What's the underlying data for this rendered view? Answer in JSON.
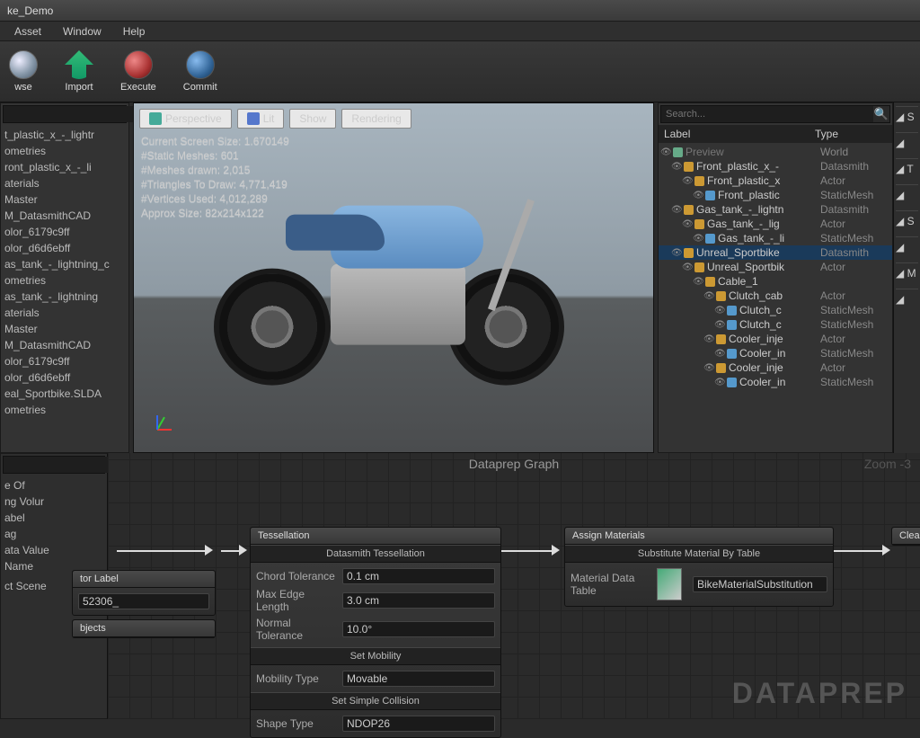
{
  "titlebar": {
    "title": "ke_Demo"
  },
  "menubar": {
    "asset": "Asset",
    "window": "Window",
    "help": "Help"
  },
  "toolbar": {
    "browse": "wse",
    "import": "Import",
    "execute": "Execute",
    "commit": "Commit"
  },
  "left_search_placeholder": "",
  "left_tree": [
    "t_plastic_x_-_lightr",
    "ometries",
    "ront_plastic_x_-_li",
    "aterials",
    "Master",
    "M_DatasmithCAD",
    "olor_6179c9ff",
    "olor_d6d6ebff",
    "as_tank_-_lightning_c",
    "ometries",
    "as_tank_-_lightning",
    "aterials",
    "Master",
    "M_DatasmithCAD",
    "olor_6179c9ff",
    "olor_d6d6ebff",
    "eal_Sportbike.SLDA",
    "ometries"
  ],
  "left_lower_search_placeholder": "",
  "left_lower": [
    "e Of",
    "ng Volur",
    "abel",
    "ag",
    "ata Value",
    "Name",
    "",
    "ct Scene"
  ],
  "viewport": {
    "btn_perspective": "Perspective",
    "btn_lit": "Lit",
    "btn_show": "Show",
    "btn_rendering": "Rendering",
    "stats": [
      "Current Screen Size: 1.670149",
      "#Static Meshes:  601",
      "#Meshes drawn:  2,015",
      "#Triangles To Draw: 4,771,419",
      "#Vertices Used:  4,012,289",
      "Approx Size: 82x214x122"
    ]
  },
  "outliner": {
    "search_placeholder": "Search...",
    "col_label": "Label",
    "col_type": "Type",
    "rows": [
      {
        "indent": 0,
        "icon": "world",
        "label": "Preview",
        "type": "World",
        "sel": false,
        "dim": true
      },
      {
        "indent": 1,
        "icon": "actor",
        "label": "Front_plastic_x_-",
        "type": "Datasmith",
        "sel": false
      },
      {
        "indent": 2,
        "icon": "actor",
        "label": "Front_plastic_x",
        "type": "Actor",
        "sel": false
      },
      {
        "indent": 3,
        "icon": "mesh",
        "label": "Front_plastic",
        "type": "StaticMesh",
        "sel": false
      },
      {
        "indent": 1,
        "icon": "actor",
        "label": "Gas_tank_-_lightn",
        "type": "Datasmith",
        "sel": false
      },
      {
        "indent": 2,
        "icon": "actor",
        "label": "Gas_tank_-_lig",
        "type": "Actor",
        "sel": false
      },
      {
        "indent": 3,
        "icon": "mesh",
        "label": "Gas_tank_-_li",
        "type": "StaticMesh",
        "sel": false
      },
      {
        "indent": 1,
        "icon": "actor",
        "label": "Unreal_Sportbike",
        "type": "Datasmith",
        "sel": true
      },
      {
        "indent": 2,
        "icon": "actor",
        "label": "Unreal_Sportbik",
        "type": "Actor",
        "sel": false
      },
      {
        "indent": 3,
        "icon": "actor",
        "label": "Cable_1",
        "type": "",
        "sel": false
      },
      {
        "indent": 4,
        "icon": "actor",
        "label": "Clutch_cab",
        "type": "Actor",
        "sel": false
      },
      {
        "indent": 5,
        "icon": "mesh",
        "label": "Clutch_c",
        "type": "StaticMesh",
        "sel": false
      },
      {
        "indent": 5,
        "icon": "mesh",
        "label": "Clutch_c",
        "type": "StaticMesh",
        "sel": false
      },
      {
        "indent": 4,
        "icon": "actor",
        "label": "Cooler_inje",
        "type": "Actor",
        "sel": false
      },
      {
        "indent": 5,
        "icon": "mesh",
        "label": "Cooler_in",
        "type": "StaticMesh",
        "sel": false
      },
      {
        "indent": 4,
        "icon": "actor",
        "label": "Cooler_inje",
        "type": "Actor",
        "sel": false
      },
      {
        "indent": 5,
        "icon": "mesh",
        "label": "Cooler_in",
        "type": "StaticMesh",
        "sel": false
      }
    ]
  },
  "rightstrip": {
    "items": [
      "S",
      "",
      "T",
      "",
      "S",
      "",
      "M",
      ""
    ]
  },
  "graph": {
    "title": "Dataprep Graph",
    "zoom": "Zoom -3",
    "watermark": "DATAPREP",
    "node_label": {
      "header": "tor Label",
      "value": "52306_"
    },
    "node_objects": "bjects",
    "node_tess": {
      "header": "Tessellation",
      "section1": "Datasmith Tessellation",
      "chord_l": "Chord Tolerance",
      "chord_v": "0.1 cm",
      "edge_l": "Max Edge Length",
      "edge_v": "3.0 cm",
      "norm_l": "Normal Tolerance",
      "norm_v": "10.0°",
      "section2": "Set Mobility",
      "mob_l": "Mobility Type",
      "mob_v": "Movable",
      "section3": "Set Simple Collision",
      "shape_l": "Shape Type",
      "shape_v": "NDOP26"
    },
    "node_mat": {
      "header": "Assign Materials",
      "section": "Substitute Material By Table",
      "tbl_l": "Material Data Table",
      "tbl_v": "BikeMaterialSubstitution"
    },
    "node_cleanup": "Cleanup"
  }
}
